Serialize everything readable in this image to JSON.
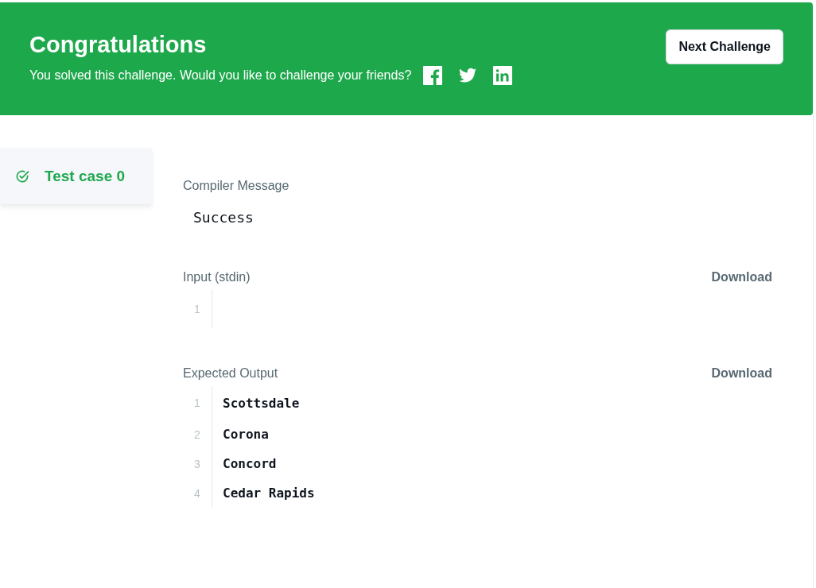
{
  "banner": {
    "title": "Congratulations",
    "message": "You solved this challenge. Would you like to challenge your friends?",
    "share_icons": [
      {
        "kind": "facebook"
      },
      {
        "kind": "twitter"
      },
      {
        "kind": "linkedin"
      }
    ],
    "button": "Next Challenge"
  },
  "test_cases": [
    {
      "label": "Test case 0",
      "selected": true,
      "passed": true
    }
  ],
  "compiler_message": {
    "label": "Compiler Message",
    "text": "Success"
  },
  "sections": [
    {
      "label": "Input (stdin)",
      "action": "Download",
      "lines": [
        {
          "number": "1"
        }
      ]
    },
    {
      "label": "Expected Output",
      "action": "Download",
      "lines": [
        {
          "number": "1",
          "text": "Scottsdale"
        },
        {
          "number": "2",
          "text": "Corona"
        },
        {
          "number": "3",
          "text": "Concord"
        },
        {
          "number": "4",
          "text": "Cedar Rapids"
        }
      ]
    }
  ]
}
